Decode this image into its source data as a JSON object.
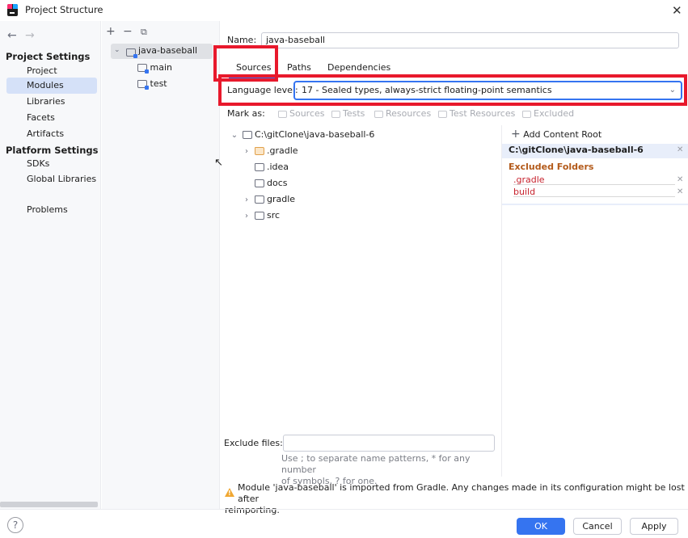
{
  "window": {
    "title": "Project Structure"
  },
  "sidebar": {
    "project_settings_header": "Project Settings",
    "project_settings_items": [
      "Project",
      "Modules",
      "Libraries",
      "Facets",
      "Artifacts"
    ],
    "selected_item": "Modules",
    "platform_settings_header": "Platform Settings",
    "platform_settings_items": [
      "SDKs",
      "Global Libraries"
    ],
    "problems": "Problems"
  },
  "module_tree": {
    "root": "java-baseball",
    "children": [
      "main",
      "test"
    ]
  },
  "module": {
    "name_label": "Name:",
    "name_value": "java-baseball",
    "tabs": [
      "Sources",
      "Paths",
      "Dependencies"
    ],
    "active_tab": "Sources",
    "language_level_label": "Language level:",
    "language_level_value": "17 - Sealed types, always-strict floating-point semantics",
    "mark_as_label": "Mark as:",
    "mark_as_buttons": [
      "Sources",
      "Tests",
      "Resources",
      "Test Resources",
      "Excluded"
    ]
  },
  "source_tree": {
    "root": "C:\\gitClone\\java-baseball-6",
    "items": [
      {
        "name": ".gradle",
        "expandable": true,
        "excluded": true
      },
      {
        "name": ".idea",
        "expandable": false,
        "excluded": false
      },
      {
        "name": "docs",
        "expandable": false,
        "excluded": false
      },
      {
        "name": "gradle",
        "expandable": true,
        "excluded": false
      },
      {
        "name": "src",
        "expandable": true,
        "excluded": false
      }
    ]
  },
  "content_root": {
    "add_label": "Add Content Root",
    "path": "C:\\gitClone\\java-baseball-6",
    "excluded_header": "Excluded Folders",
    "excluded": [
      ".gradle",
      "build"
    ]
  },
  "exclude_files": {
    "label": "Exclude files:",
    "value": "",
    "hint_line1": "Use ; to separate name patterns, * for any number",
    "hint_line2": "of symbols, ? for one."
  },
  "warning": {
    "line1": "Module 'java-baseball' is imported from Gradle. Any changes made in its configuration might be lost after",
    "line2": "reimporting."
  },
  "buttons": {
    "ok": "OK",
    "cancel": "Cancel",
    "apply": "Apply",
    "help": "?"
  },
  "colors": {
    "accent": "#3574f0",
    "highlight_box": "#e8192c",
    "excluded_text": "#c7222d",
    "warning": "#f0a732"
  }
}
